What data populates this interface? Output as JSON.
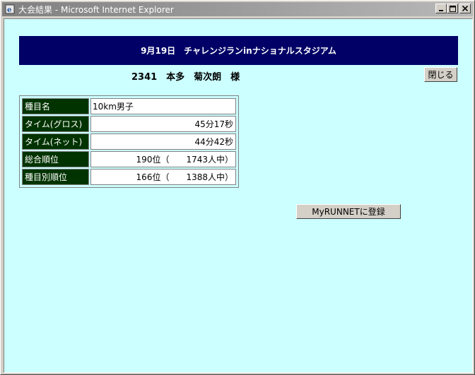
{
  "window": {
    "title": "大会結果 - Microsoft Internet Explorer",
    "minimize_glyph": "_",
    "maximize_glyph": "□",
    "close_glyph": "×"
  },
  "banner": {
    "text": "9月19日　チャレンジランinナショナルスタジアム"
  },
  "runner": {
    "line": "2341　本多　菊次朗　様"
  },
  "close_button": {
    "label": "閉じる"
  },
  "results": {
    "rows": [
      {
        "label": "種目名",
        "value": "10km男子",
        "align": "left"
      },
      {
        "label": "タイム(グロス)",
        "value": "45分17秒",
        "align": "right"
      },
      {
        "label": "タイム(ネット)",
        "value": "44分42秒",
        "align": "right"
      },
      {
        "label": "総合順位",
        "value": "190位（　　1743人中）",
        "align": "right"
      },
      {
        "label": "種目別順位",
        "value": "166位（　　1388人中）",
        "align": "right"
      }
    ]
  },
  "register_button": {
    "label": "MyRUNNETに登録"
  },
  "colors": {
    "banner_bg": "#000066",
    "label_bg": "#003300",
    "page_bg": "#ccffff"
  }
}
